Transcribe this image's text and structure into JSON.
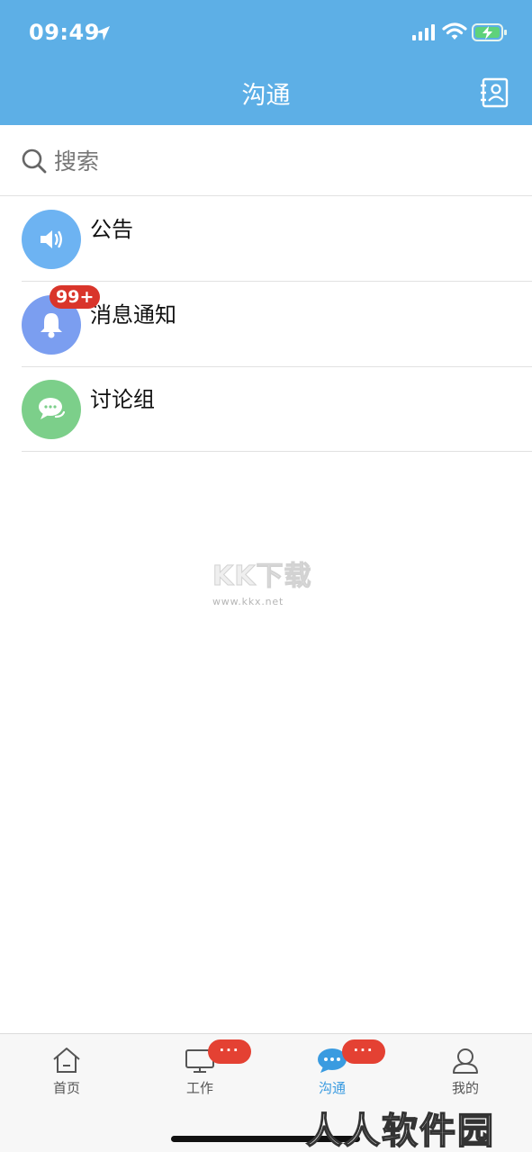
{
  "status_bar": {
    "time": "09:49"
  },
  "nav": {
    "title": "沟通"
  },
  "search": {
    "placeholder": "搜索"
  },
  "list": [
    {
      "label": "公告",
      "icon": "speaker-icon",
      "color": "#6db3f2"
    },
    {
      "label": "消息通知",
      "icon": "bell-icon",
      "color": "#7b9ef0",
      "badge": "99+"
    },
    {
      "label": "讨论组",
      "icon": "chat-bubbles-icon",
      "color": "#7ccf8a"
    }
  ],
  "watermark": {
    "logo": "KK下载",
    "url": "www.kkx.net"
  },
  "tabbar": {
    "tabs": [
      {
        "label": "首页",
        "icon": "home-icon",
        "active": false
      },
      {
        "label": "工作",
        "icon": "monitor-icon",
        "active": false,
        "badge": "···"
      },
      {
        "label": "沟通",
        "icon": "chat-icon",
        "active": true,
        "badge": "···"
      },
      {
        "label": "我的",
        "icon": "profile-icon",
        "active": false
      }
    ]
  },
  "corner_watermark": "人人软件园",
  "colors": {
    "header": "#5dafe6",
    "badge": "#d9352b",
    "active_tab": "#3a9be0"
  }
}
